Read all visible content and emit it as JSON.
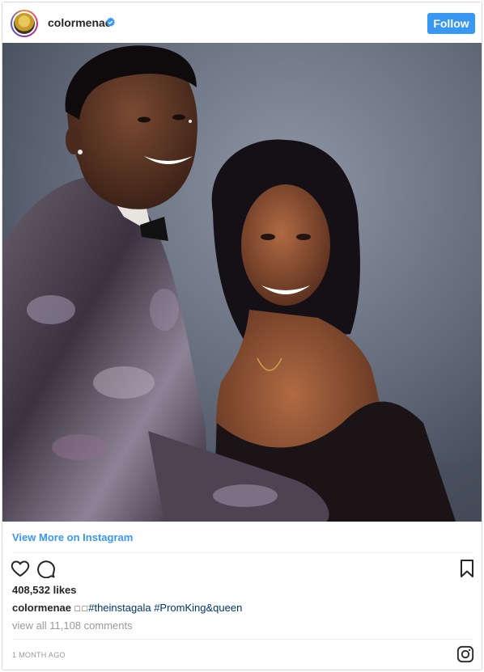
{
  "header": {
    "username": "colormenae",
    "verified": true,
    "follow_label": "Follow"
  },
  "photo": {
    "icon": "photo-of-couple"
  },
  "links": {
    "view_more": "View More on Instagram"
  },
  "actions": {
    "like_icon": "heart-icon",
    "comment_icon": "comment-icon",
    "save_icon": "bookmark-icon"
  },
  "stats": {
    "likes": "408,532 likes"
  },
  "caption": {
    "user": "colormenae",
    "emoji": "☐☐",
    "text_1": "#theinstagala",
    "text_2": "#PromKing&queen"
  },
  "comments": {
    "view_all": "view all 11,108 comments"
  },
  "footer": {
    "timestamp": "1 MONTH AGO",
    "logo_icon": "instagram-icon"
  },
  "colors": {
    "accent": "#3897f0",
    "text": "#262626",
    "muted": "#999999",
    "hashtag": "#003569"
  }
}
